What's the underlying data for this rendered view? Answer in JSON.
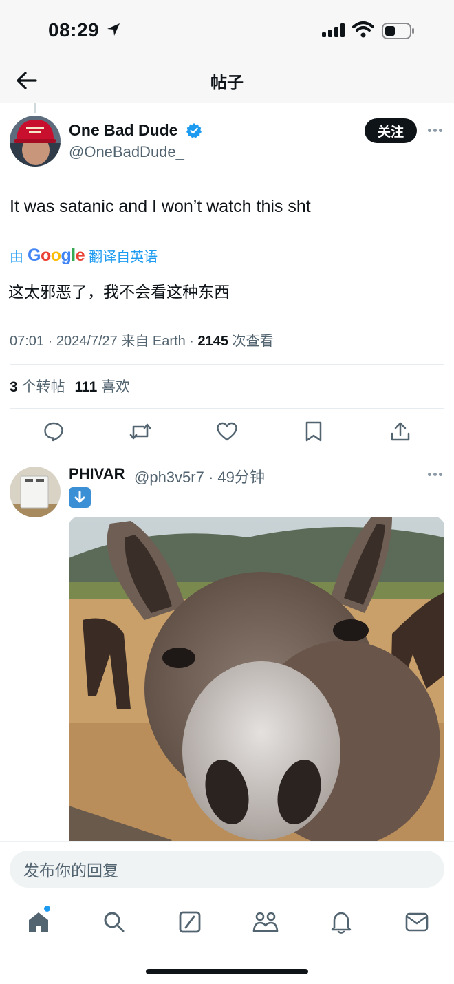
{
  "status_bar": {
    "time": "08:29"
  },
  "nav": {
    "title": "帖子"
  },
  "tweet": {
    "author_name": "One Bad Dude",
    "author_handle": "@OneBadDude_",
    "follow_label": "关注",
    "text": "It was satanic and I won’t watch this sht",
    "translate_prefix": "由",
    "translate_brand": "Google",
    "translate_suffix": "翻译自英语",
    "translated_text": "这太邪恶了，我不会看这种东西",
    "meta_time": "07:01 · 2024/7/27 来自 Earth · ",
    "meta_views": "2145",
    "meta_views_label": " 次查看",
    "reposts_count": "3",
    "reposts_label": " 个转帖",
    "likes_count": "111",
    "likes_label": " 喜欢"
  },
  "reply": {
    "author_name": "PHIVAR",
    "author_handle": "@ph3v5r7 · 49分钟"
  },
  "compose": {
    "placeholder": "发布你的回复"
  },
  "icons": {
    "actions": [
      "reply-icon",
      "retweet-icon",
      "like-icon",
      "bookmark-icon",
      "share-icon"
    ],
    "tabs": [
      "home-icon",
      "search-icon",
      "grok-icon",
      "communities-icon",
      "notifications-icon",
      "messages-icon"
    ]
  },
  "colors": {
    "accent": "#1d9bf0",
    "text": "#0f1419",
    "muted": "#536471"
  }
}
